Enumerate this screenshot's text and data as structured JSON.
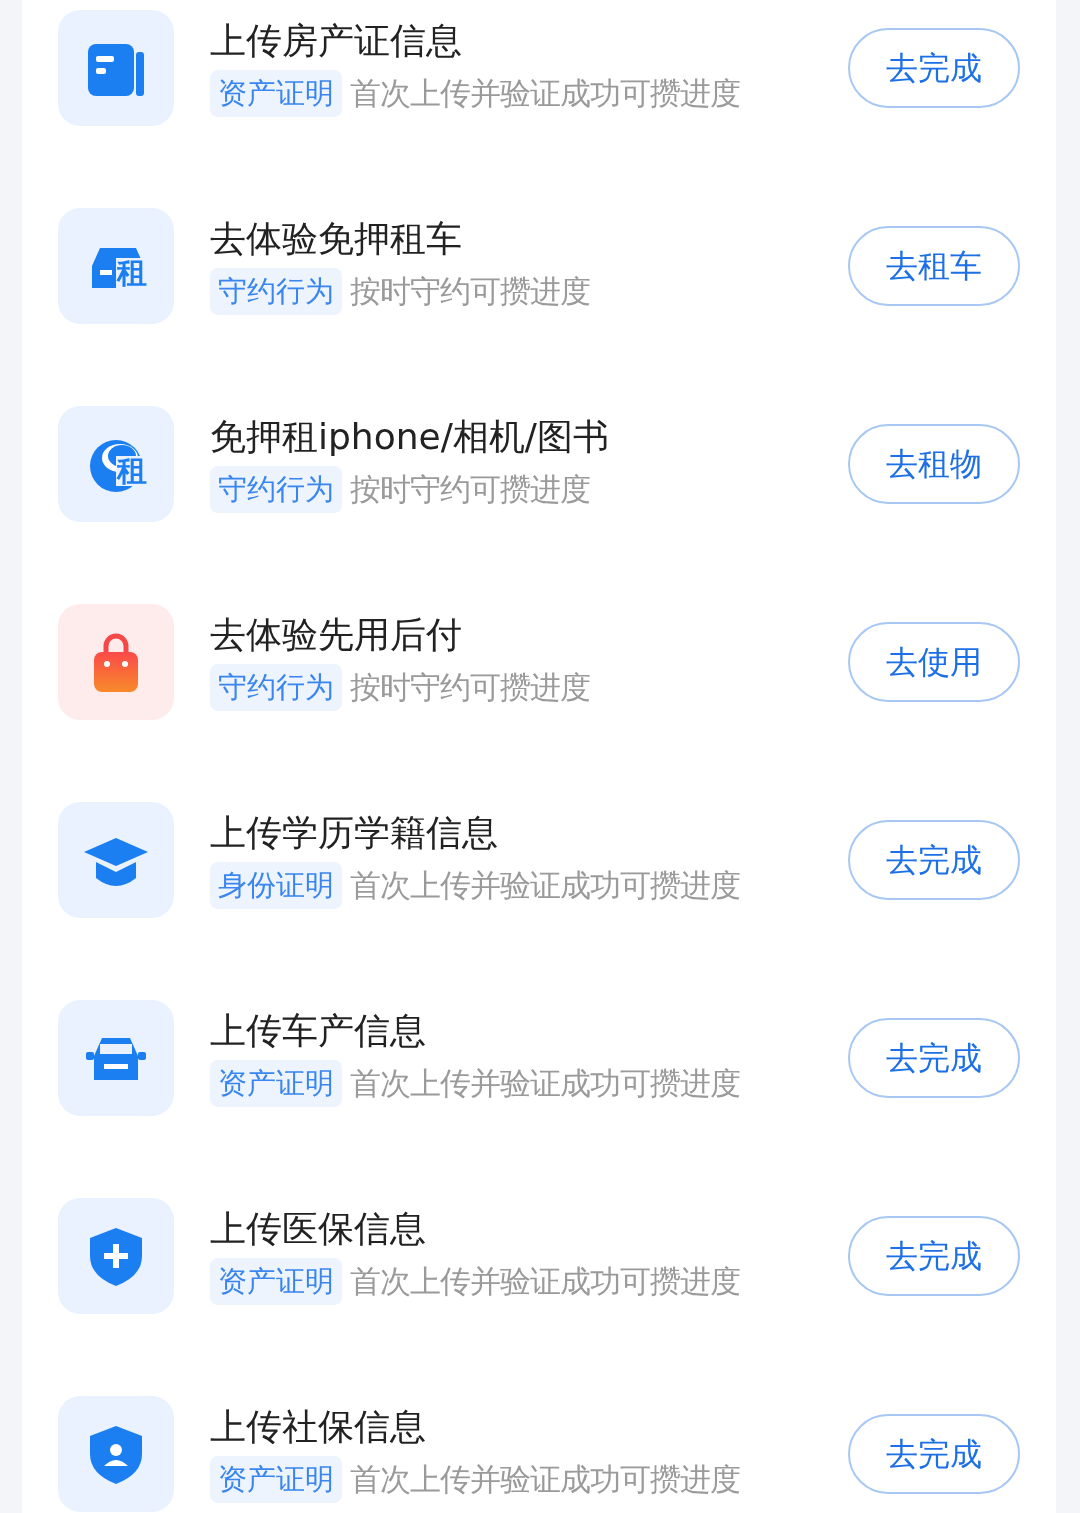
{
  "tasks": [
    {
      "title": "上传房产证信息",
      "tag": "资产证明",
      "desc": "首次上传并验证成功可攒进度",
      "button": "去完成"
    },
    {
      "title": "去体验免押租车",
      "icon_label": "租",
      "tag": "守约行为",
      "desc": "按时守约可攒进度",
      "button": "去租车"
    },
    {
      "title": "免押租iphone/相机/图书",
      "icon_label": "租",
      "tag": "守约行为",
      "desc": "按时守约可攒进度",
      "button": "去租物"
    },
    {
      "title": "去体验先用后付",
      "tag": "守约行为",
      "desc": "按时守约可攒进度",
      "button": "去使用"
    },
    {
      "title": "上传学历学籍信息",
      "tag": "身份证明",
      "desc": "首次上传并验证成功可攒进度",
      "button": "去完成"
    },
    {
      "title": "上传车产信息",
      "tag": "资产证明",
      "desc": "首次上传并验证成功可攒进度",
      "button": "去完成"
    },
    {
      "title": "上传医保信息",
      "tag": "资产证明",
      "desc": "首次上传并验证成功可攒进度",
      "button": "去完成"
    },
    {
      "title": "上传社保信息",
      "tag": "资产证明",
      "desc": "首次上传并验证成功可攒进度",
      "button": "去完成"
    }
  ]
}
